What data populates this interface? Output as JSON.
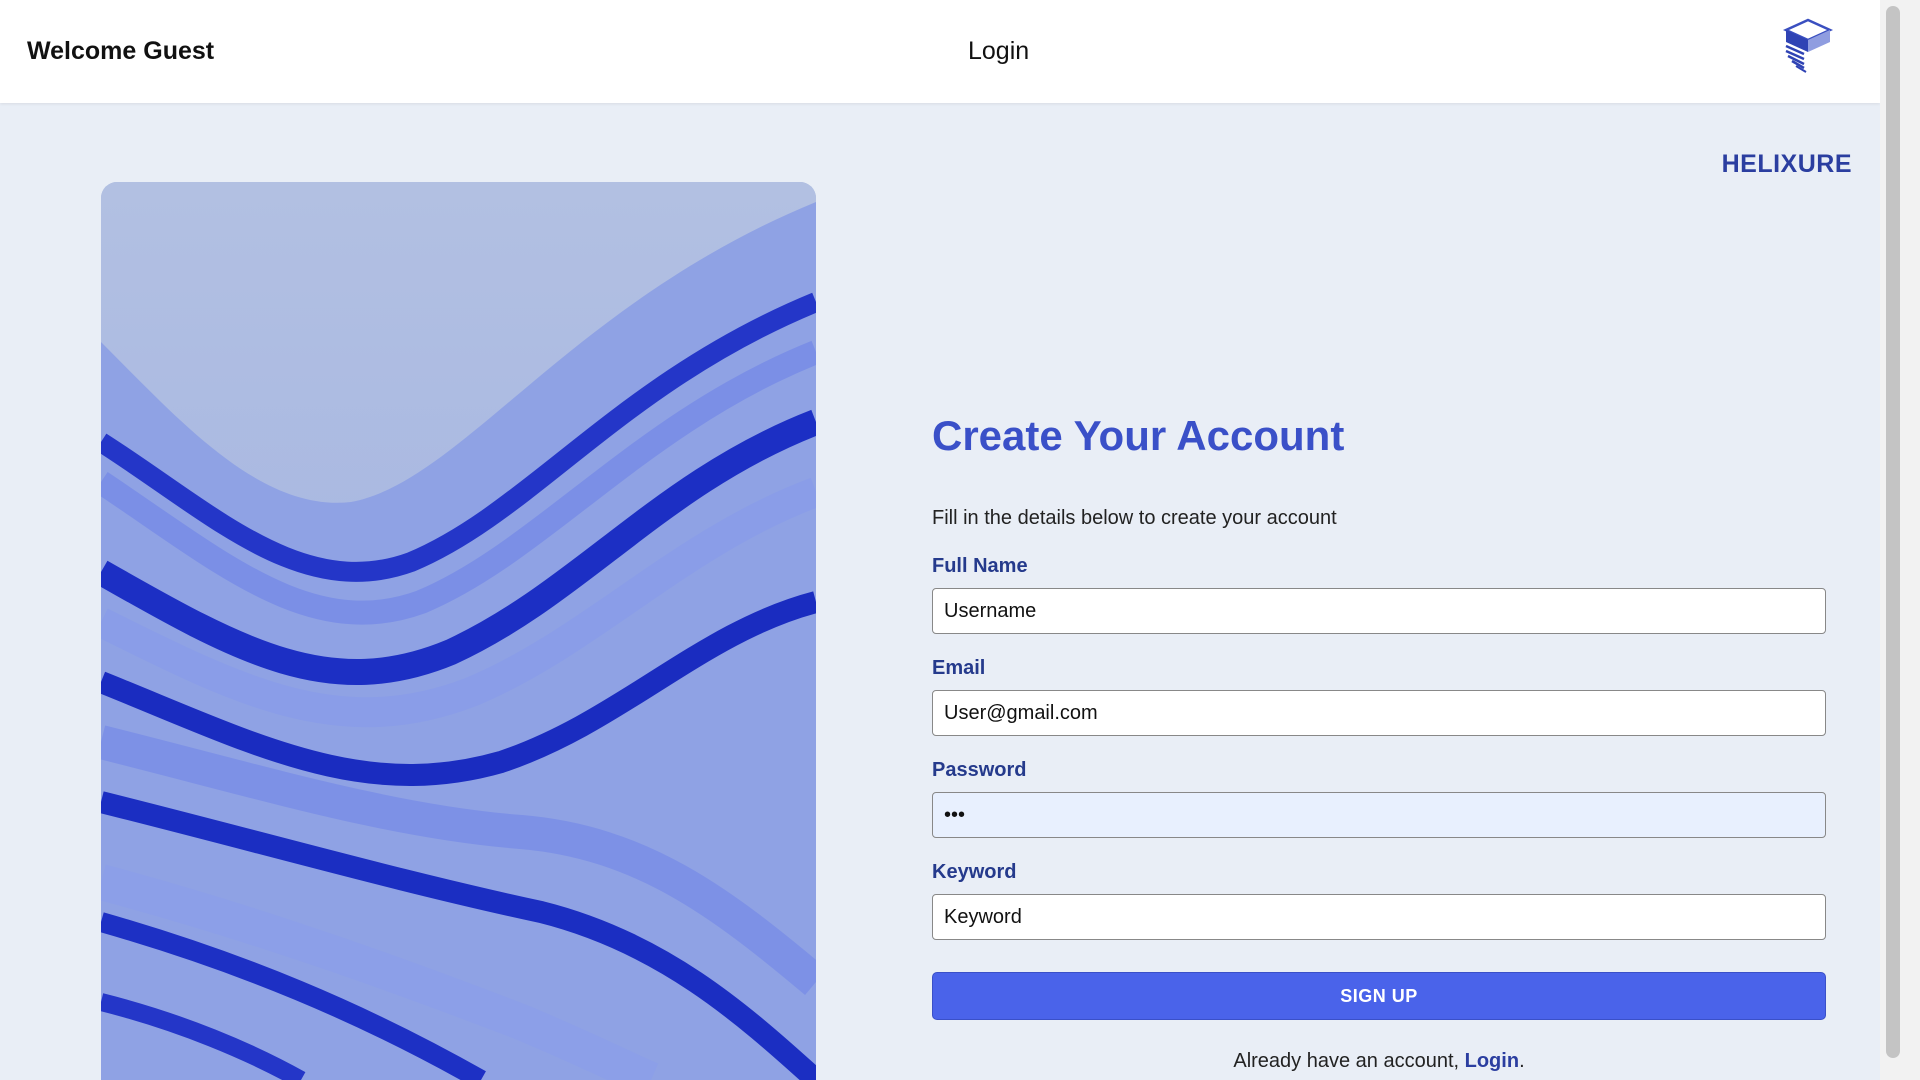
{
  "header": {
    "welcome_text": "Welcome Guest",
    "nav_login": "Login",
    "logo_icon": "cube-stack-icon"
  },
  "brand": {
    "name": "HELIXURE"
  },
  "illustration": {
    "icon": "blue-wave-ribbons-image"
  },
  "form": {
    "title": "Create Your Account",
    "subtitle": "Fill in the details below to create your account",
    "fields": [
      {
        "label": "Full Name",
        "value": "Username",
        "type": "text"
      },
      {
        "label": "Email",
        "value": "User@gmail.com",
        "type": "email"
      },
      {
        "label": "Password",
        "value": "•••",
        "type": "password"
      },
      {
        "label": "Keyword",
        "value": "Keyword",
        "type": "text"
      }
    ],
    "submit_label": "SIGN UP",
    "footer_prefix": "Already have an account, ",
    "footer_link": "Login",
    "footer_suffix": "."
  },
  "colors": {
    "accent": "#4a63ea",
    "heading": "#3a50c8",
    "label": "#253a8c",
    "page_bg": "#e9eef6"
  }
}
